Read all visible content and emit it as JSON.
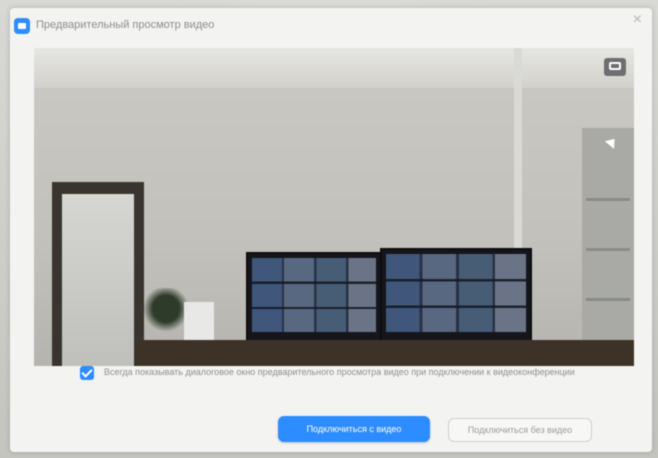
{
  "window": {
    "title": "Предварительный просмотр видео",
    "close_symbol": "×"
  },
  "video_preview": {
    "camera_switch_icon": "camera-switch-icon"
  },
  "option": {
    "checked": true,
    "text": "Всегда показывать диалоговое окно предварительного просмотра видео при подключении к видеоконференции"
  },
  "buttons": {
    "join_with_video": "Подключиться с видео",
    "join_without_video": "Подключиться без видео"
  },
  "colors": {
    "accent": "#2d8cff",
    "dialog_bg": "#f3f3f1"
  }
}
